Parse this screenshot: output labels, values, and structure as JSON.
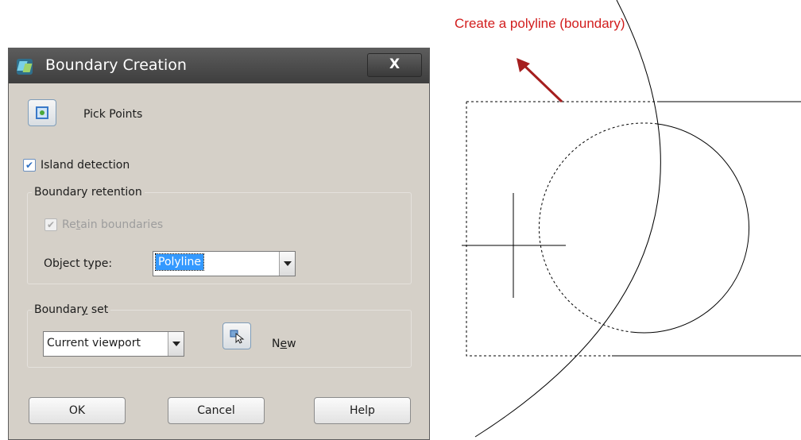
{
  "dialog": {
    "title": "Boundary Creation",
    "close_label": "X",
    "pick_points_label": "Pick Points",
    "island_detection": {
      "label": "Island detection",
      "checked": true
    },
    "boundary_retention": {
      "title": "Boundary retention",
      "retain_pre": "Re",
      "retain_key": "t",
      "retain_post": "ain boundaries",
      "retain_checked": true,
      "object_type_label": "Object type:",
      "object_type_value": "Polyline"
    },
    "boundary_set": {
      "title_pre": "Boundar",
      "title_key": "y",
      "title_post": " set",
      "value": "Current viewport",
      "new_pre": "N",
      "new_key": "e",
      "new_post": "w"
    },
    "buttons": {
      "ok": "OK",
      "cancel": "Cancel",
      "help": "Help"
    }
  },
  "drawing": {
    "caption": "Create a polyline (boundary)",
    "caption_color": "#d21d1d",
    "arrow_color": "#a51e1e"
  },
  "colors": {
    "dialog_bg": "#d5d0c8",
    "titlebar": "#4a4a4a",
    "selection": "#3399ff",
    "check_accent": "#2e6fc2"
  }
}
